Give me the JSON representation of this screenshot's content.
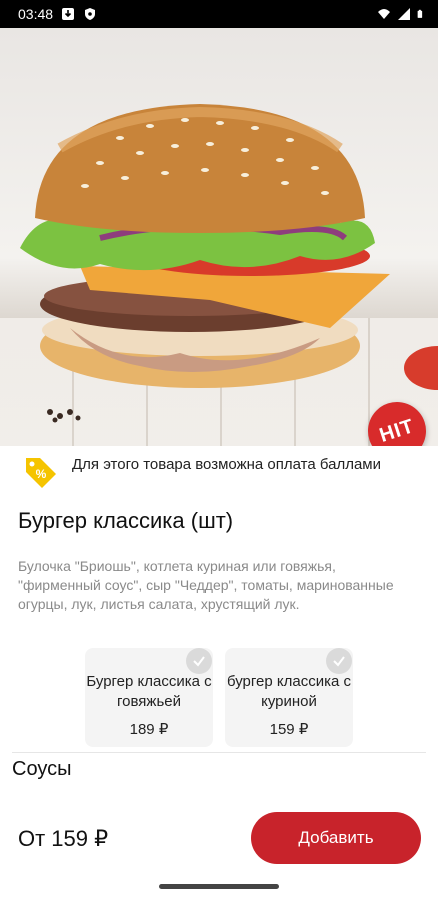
{
  "status_bar": {
    "time": "03:48",
    "icons": [
      "download-icon",
      "shield-icon",
      "wifi-icon",
      "signal-icon",
      "battery-icon"
    ]
  },
  "hero": {
    "image": "burger-photo",
    "badge_text": "HIT"
  },
  "points_note": {
    "icon": "percent-tag-icon",
    "text": "Для этого товара возможна оплата баллами"
  },
  "product": {
    "title": "Бургер классика (шт)",
    "description": "Булочка \"Бриошь\", котлета куриная или говяжья, \"фирменный соус\", сыр \"Чеддер\", томаты, маринованные огурцы, лук, листья салата, хрустящий лук."
  },
  "variants": [
    {
      "name": "Бургер классика с говяжьей",
      "price": "189 ₽"
    },
    {
      "name": "бургер классика с куриной",
      "price": "159 ₽"
    }
  ],
  "sauces": {
    "title": "Соусы"
  },
  "footer": {
    "price": "От 159 ₽",
    "add_label": "Добавить"
  },
  "colors": {
    "accent": "#c8232b",
    "badge": "#d82b2b",
    "points_tag": "#f5c400"
  }
}
